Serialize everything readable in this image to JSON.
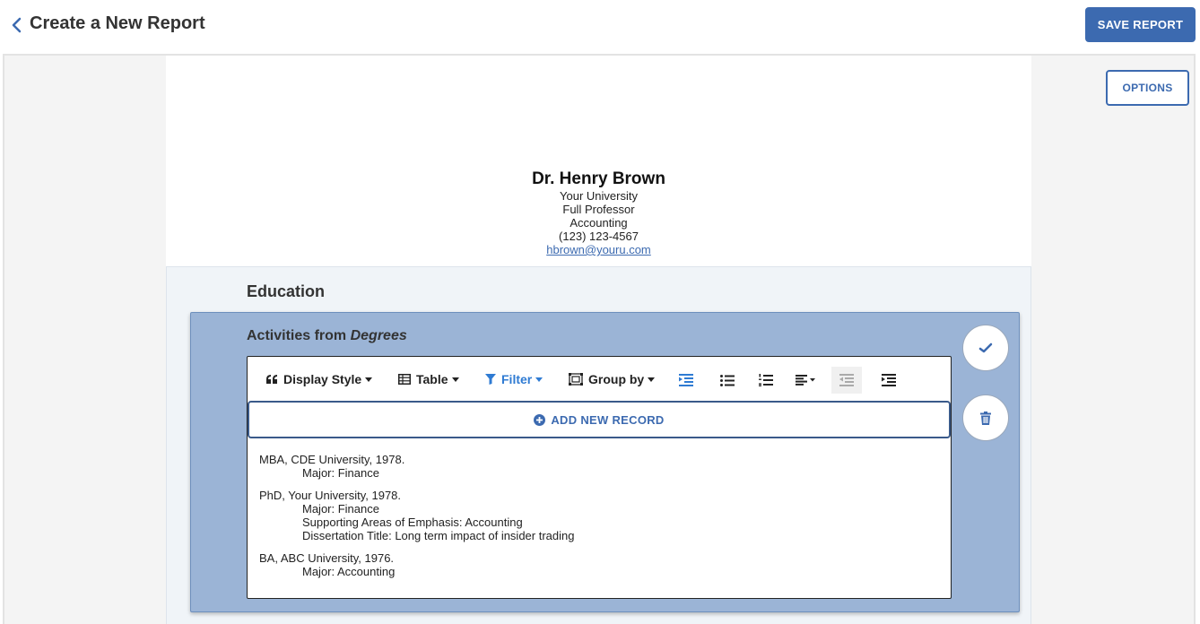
{
  "header": {
    "title": "Create a New Report",
    "save_label": "SAVE REPORT"
  },
  "options_label": "OPTIONS",
  "profile": {
    "name": "Dr. Henry Brown",
    "institution": "Your University",
    "rank": "Full Professor",
    "department": "Accounting",
    "phone": "(123) 123-4567",
    "email": "hbrown@youru.com"
  },
  "section": {
    "title": "Education",
    "activity_prefix": "Activities from",
    "activity_source": "Degrees"
  },
  "toolbar": {
    "display_style": "Display Style",
    "table": "Table",
    "filter": "Filter",
    "group_by": "Group by",
    "filter_color": "#2f7bd3"
  },
  "add_record_label": "ADD NEW RECORD",
  "records": [
    {
      "title": "MBA, CDE University, 1978.",
      "details": [
        "Major: Finance"
      ]
    },
    {
      "title": "PhD, Your University, 1978.",
      "details": [
        "Major: Finance",
        "Supporting Areas of Emphasis: Accounting",
        "Dissertation Title: Long term impact of insider trading"
      ]
    },
    {
      "title": "BA, ABC University, 1976.",
      "details": [
        "Major: Accounting"
      ]
    }
  ],
  "colors": {
    "accent": "#3c6ab0",
    "panel": "#9bb4d6"
  }
}
